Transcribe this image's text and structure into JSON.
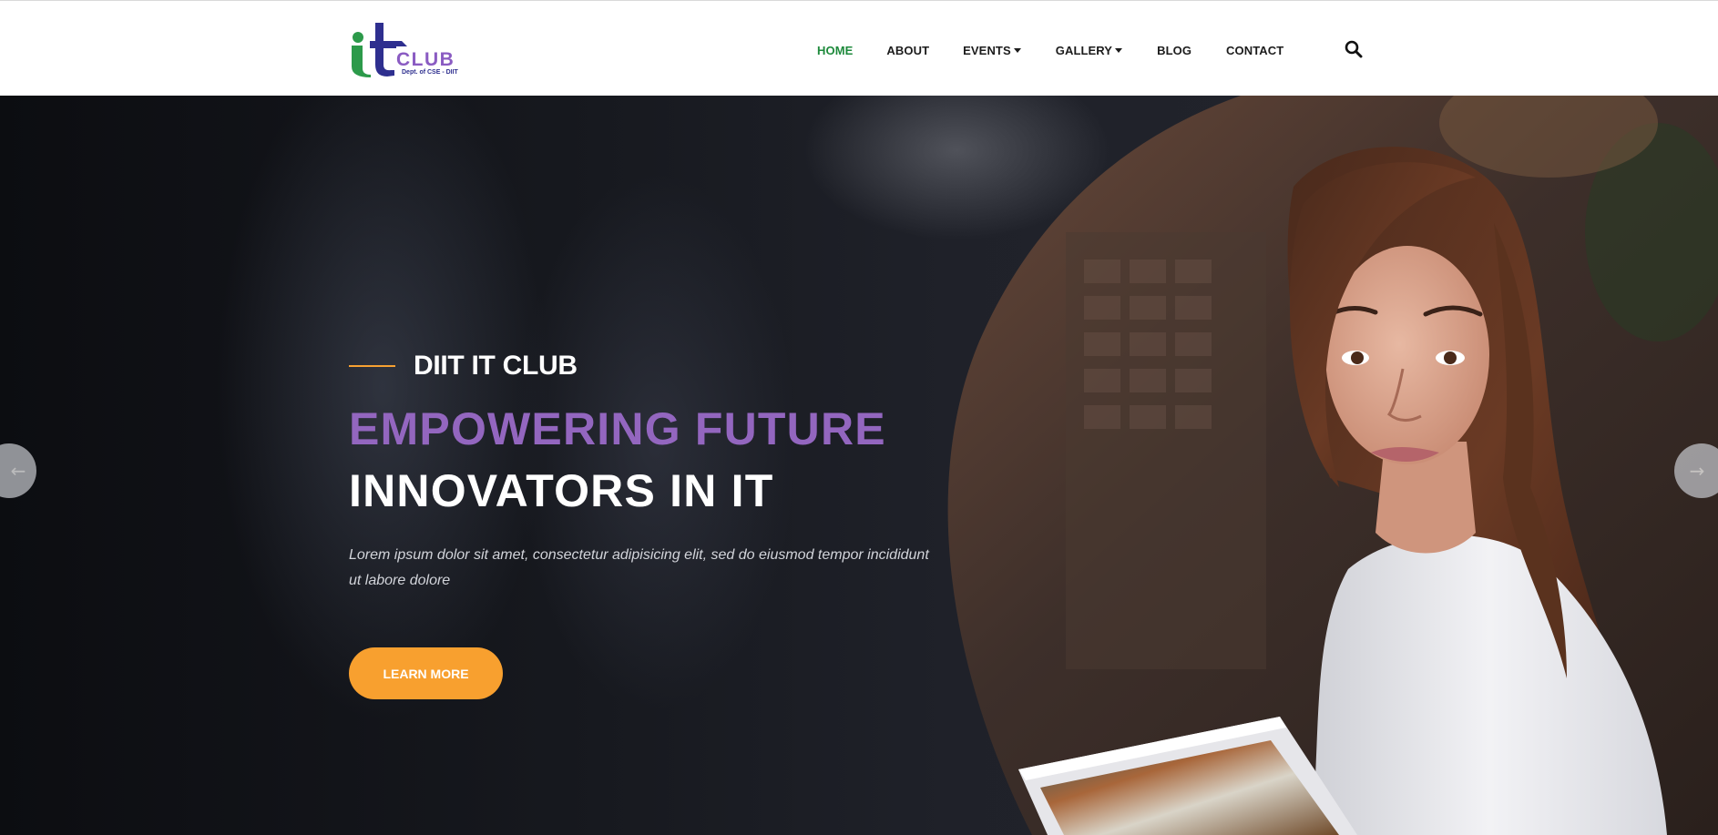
{
  "site": {
    "logo": {
      "mark": "it",
      "word": "CLUB",
      "tagline": "Dept. of CSE - DIIT",
      "colors": {
        "i": "#2c9a4a",
        "t": "#2e2f8f",
        "club": "#8a5bc2"
      }
    }
  },
  "nav": {
    "items": [
      {
        "label": "HOME",
        "active": true
      },
      {
        "label": "ABOUT"
      },
      {
        "label": "EVENTS",
        "dropdown": true
      },
      {
        "label": "GALLERY",
        "dropdown": true
      },
      {
        "label": "BLOG"
      },
      {
        "label": "CONTACT"
      }
    ],
    "active_color": "#1e8a3c",
    "search_icon": "search-icon"
  },
  "hero": {
    "eyebrow": "DIIT IT CLUB",
    "headline_line1": "EMPOWERING FUTURE",
    "headline_line2": "INNOVATORS IN IT",
    "description": "Lorem ipsum dolor sit amet, consectetur adipisicing elit, sed do eiusmod tempor incididunt ut labore dolore",
    "cta_label": "LEARN MORE",
    "prev_arrow": "←",
    "next_arrow": "→",
    "accent_color": "#f8a02f",
    "headline_color": "#9366bf"
  }
}
